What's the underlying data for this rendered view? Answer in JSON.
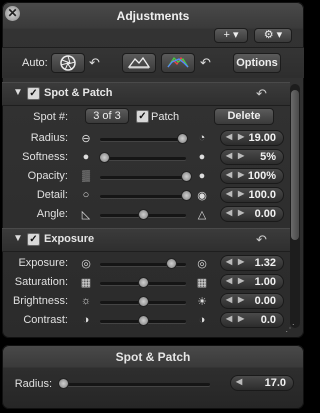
{
  "window": {
    "title": "Adjustments",
    "close_glyph": "✕"
  },
  "header_buttons": {
    "add_label": "+ ▾",
    "gear_label": "⚙ ▾"
  },
  "toolbar": {
    "auto_label": "Auto:",
    "options_label": "Options",
    "icons": [
      "aperture-icon",
      "undo-arrow-icon",
      "levels-mountain-icon",
      "color-levels-icon",
      "undo-arrow-icon"
    ]
  },
  "spot_patch": {
    "title": "Spot & Patch",
    "spot_label": "Spot #:",
    "spot_value": "3 of 3",
    "patch_label": "Patch",
    "delete_label": "Delete",
    "rows": [
      {
        "label": "Radius:",
        "value": "19.00",
        "level": 0.95
      },
      {
        "label": "Softness:",
        "value": "5%",
        "level": 0.05
      },
      {
        "label": "Opacity:",
        "value": "100%",
        "level": 1.0
      },
      {
        "label": "Detail:",
        "value": "100.0",
        "level": 1.0
      },
      {
        "label": "Angle:",
        "value": "0.00",
        "level": 0.5
      }
    ]
  },
  "exposure": {
    "title": "Exposure",
    "rows": [
      {
        "label": "Exposure:",
        "value": "1.32",
        "level": 0.83
      },
      {
        "label": "Saturation:",
        "value": "1.00",
        "level": 0.5
      },
      {
        "label": "Brightness:",
        "value": "0.00",
        "level": 0.5
      },
      {
        "label": "Contrast:",
        "value": "0.0",
        "level": 0.5
      }
    ]
  },
  "spot_patch_hud": {
    "title": "Spot & Patch",
    "radius_label": "Radius:",
    "radius_value": "17.0",
    "radius_level": 0.02
  }
}
